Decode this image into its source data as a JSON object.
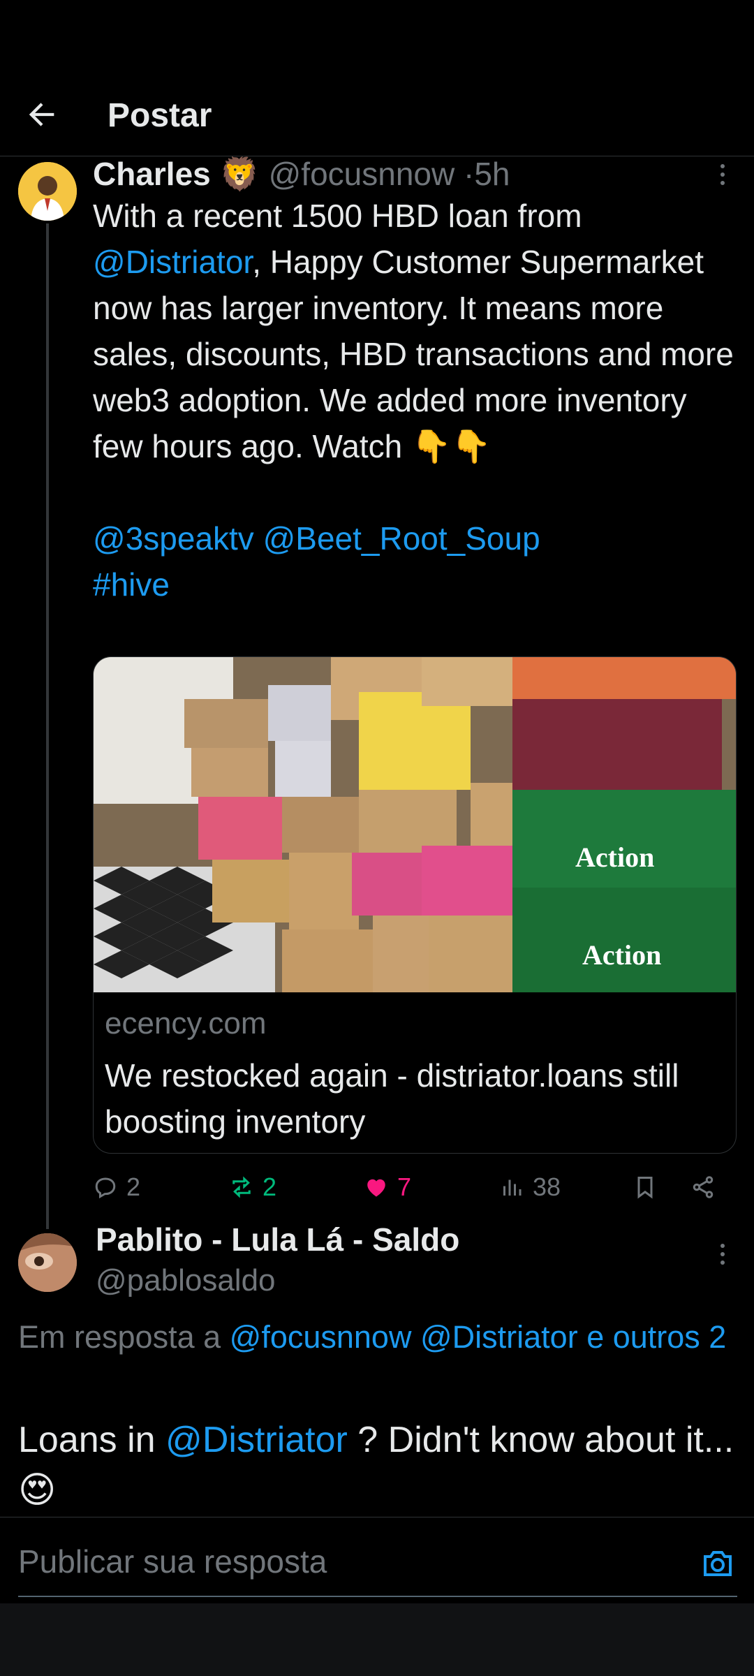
{
  "header": {
    "title": "Postar"
  },
  "tweet": {
    "name": "Charles",
    "name_emoji": "🦁",
    "handle": "@focusnnow",
    "separator": "·",
    "time": "5h",
    "text_part1": "With a recent 1500 HBD loan from",
    "mention1": "@Distriator",
    "text_part2": ", Happy Customer Supermarket now has larger inventory. It means more sales, discounts, HBD transactions and more web3 adoption. We added more inventory few hours ago. Watch ",
    "watch_emoji": "👇👇",
    "mention2": "@3speaktv",
    "mention3": "@Beet_Root_Soup",
    "hashtag": "#hive"
  },
  "card": {
    "domain": "ecency.com",
    "title": "We restocked again - distriator.loans still boosting inventory"
  },
  "actions": {
    "replies": "2",
    "retweets": "2",
    "likes": "7",
    "views": "38"
  },
  "colors": {
    "accent": "#1d9bf0",
    "retweet": "#00ba7c",
    "like": "#f91880",
    "muted": "#71767b"
  },
  "reply": {
    "name": "Pablito - Lula Lá - Saldo",
    "handle": "@pablosaldo",
    "in_reply_prefix": "Em resposta a ",
    "in_reply_mention1": "@focusnnow",
    "in_reply_mention2": "@Distriator",
    "in_reply_more": "e outros 2",
    "text_part1": "Loans in ",
    "text_mention": "@Distriator",
    "text_part2": " ? Didn't know about it... ",
    "text_emoji": "😍"
  },
  "compose": {
    "placeholder": "Publicar sua resposta"
  }
}
